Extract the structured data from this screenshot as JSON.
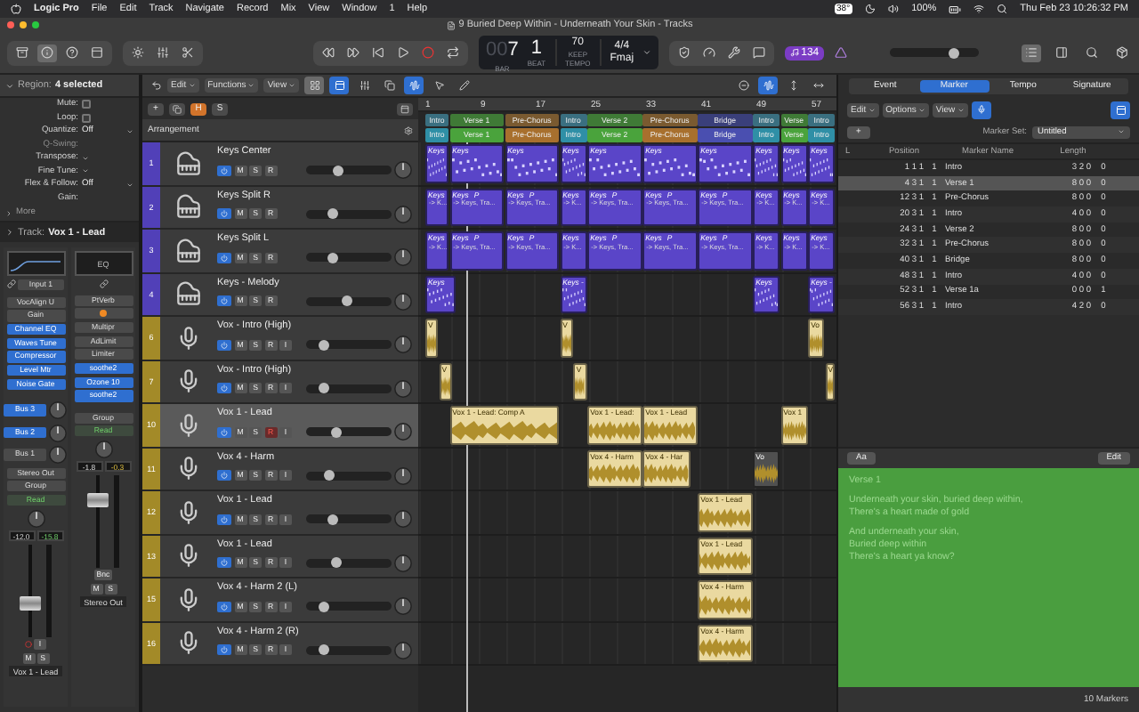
{
  "menu_bar": {
    "app": "Logic Pro",
    "items": [
      "File",
      "Edit",
      "Track",
      "Navigate",
      "Record",
      "Mix",
      "View",
      "Window",
      "1",
      "Help"
    ],
    "temperature": "38°",
    "battery": "100%",
    "clock": "Thu Feb 23  10:26:32 PM"
  },
  "window": {
    "title": "9 Buried Deep Within - Underneath Your Skin - Tracks"
  },
  "lcd": {
    "bar_prefix": "00",
    "bar": "7",
    "beat": "1",
    "bar_label": "BAR",
    "beat_label": "BEAT",
    "tempo": "70",
    "tempo_mode": "KEEP",
    "tempo_label": "TEMPO",
    "signature": "4/4",
    "key": "Fmaj"
  },
  "badge": "134",
  "master_volume": {
    "level": 0.72
  },
  "inspector": {
    "region_label": "Region:",
    "region_value": "4 selected",
    "params": [
      {
        "label": "Mute:",
        "kind": "checkbox",
        "checked": false,
        "disabled": false
      },
      {
        "label": "Loop:",
        "kind": "checkbox",
        "checked": false,
        "disabled": false
      },
      {
        "label": "Quantize:",
        "kind": "popup",
        "value": "Off",
        "disabled": false
      },
      {
        "label": "Q-Swing:",
        "kind": "label",
        "disabled": true
      },
      {
        "label": "Transpose:",
        "kind": "popup",
        "disabled": false
      },
      {
        "label": "Fine Tune:",
        "kind": "popup",
        "disabled": false
      },
      {
        "label": "Flex & Follow:",
        "kind": "popup",
        "value": "Off",
        "disabled": false
      },
      {
        "label": "Gain:",
        "kind": "label",
        "disabled": false
      }
    ],
    "more": "More",
    "track_label": "Track:",
    "track_value": "Vox 1 - Lead"
  },
  "strips": [
    {
      "eq": {
        "kind": "curve"
      },
      "input": "Input 1",
      "plugins": [
        {
          "name": "VocAlign U",
          "active": false,
          "warning": false
        },
        {
          "name": "Gain",
          "active": false,
          "warning": false
        },
        {
          "name": "Channel EQ",
          "active": true,
          "warning": false
        },
        {
          "name": "Waves Tune",
          "active": true,
          "warning": false
        },
        {
          "name": "Compressor",
          "active": true,
          "warning": false
        },
        {
          "name": "Level Mtr",
          "active": true,
          "warning": false
        },
        {
          "name": "Noise Gate",
          "active": true,
          "warning": false
        }
      ],
      "sends": [
        {
          "name": "Bus 3",
          "active": true
        },
        {
          "name": "Bus 2",
          "active": true
        },
        {
          "name": "Bus 1",
          "active": false
        }
      ],
      "output": "Stereo Out",
      "group": "Group",
      "automation": "Read",
      "volume": "-12.0",
      "peak": "-15.8",
      "level": 0.35,
      "input_button": "I",
      "mute": "M",
      "solo": "S",
      "name": "Vox 1 - Lead"
    },
    {
      "eq": {
        "kind": "label",
        "text": "EQ"
      },
      "plugins": [
        {
          "name": "PtVerb",
          "active": false,
          "warning": false
        },
        {
          "active": false,
          "warning": true
        },
        {
          "name": "Multipr",
          "active": false,
          "warning": false
        },
        {
          "name": "AdLimit",
          "active": false,
          "warning": false
        },
        {
          "name": "Limiter",
          "active": false,
          "warning": false
        },
        {
          "name": "soothe2",
          "active": true,
          "warning": false
        },
        {
          "name": "Ozone 10",
          "active": true,
          "warning": false
        },
        {
          "name": "soothe2",
          "active": true,
          "warning": false
        }
      ],
      "group": "Group",
      "automation": "Read",
      "volume": "-1.8",
      "peak": "-0.3",
      "level": 0.72,
      "bounce": "Bnc",
      "mute": "M",
      "solo": "S",
      "name": "Stereo Out"
    }
  ],
  "arrange_toolbar": {
    "menus": [
      "Edit",
      "Functions",
      "View"
    ]
  },
  "track_toolbar": {
    "add": "+",
    "h": "H",
    "s": "S",
    "arrangement": "Arrangement"
  },
  "ruler": [
    "1",
    "9",
    "17",
    "25",
    "33",
    "41",
    "49",
    "57"
  ],
  "arrangement_markers": [
    {
      "name": "Intro",
      "color": "#3a6f80"
    },
    {
      "name": "Verse 1",
      "color": "#3f7a36"
    },
    {
      "name": "Pre-Chorus",
      "color": "#7a5a30"
    },
    {
      "name": "Intro",
      "color": "#3a6f80"
    },
    {
      "name": "Verse 2",
      "color": "#3f7a36"
    },
    {
      "name": "Pre-Chorus",
      "color": "#7a5a30"
    },
    {
      "name": "Bridge",
      "color": "#3a3f7a"
    },
    {
      "name": "Intro",
      "color": "#3a6f80"
    },
    {
      "name": "Verse",
      "color": "#3f7a36"
    },
    {
      "name": "Intro",
      "color": "#3a6f80"
    }
  ],
  "markers": [
    {
      "name": "Intro",
      "color": "#2f8fa6"
    },
    {
      "name": "Verse 1",
      "color": "#4aa33c"
    },
    {
      "name": "Pre-Chorus",
      "color": "#a8702e"
    },
    {
      "name": "Intro",
      "color": "#2f8fa6"
    },
    {
      "name": "Verse 2",
      "color": "#4aa33c"
    },
    {
      "name": "Pre-Chorus",
      "color": "#a8702e"
    },
    {
      "name": "Bridge",
      "color": "#4a4fb0"
    },
    {
      "name": "Intro",
      "color": "#2f8fa6"
    },
    {
      "name": "Verse",
      "color": "#4aa33c"
    },
    {
      "name": "Intro",
      "color": "#2f8fa6"
    }
  ],
  "tracks": [
    {
      "number": "1",
      "name": "Keys Center",
      "kind": "keys",
      "buttons": [
        "M",
        "S",
        "R"
      ],
      "selected": false,
      "armed": false,
      "level": 0.38,
      "regions": [
        {
          "name": "Keys",
          "kind": "midi"
        },
        {
          "name": "Keys",
          "kind": "midi"
        },
        {
          "name": "Keys",
          "kind": "midi"
        },
        {
          "name": "Keys",
          "kind": "midi"
        },
        {
          "name": "Keys",
          "kind": "midi"
        },
        {
          "name": "Keys",
          "kind": "midi"
        },
        {
          "name": "Keys",
          "kind": "midi"
        },
        {
          "name": "Keys",
          "kind": "midi"
        },
        {
          "name": "Keys",
          "kind": "midi"
        },
        {
          "name": "Keys",
          "kind": "midi"
        }
      ]
    },
    {
      "number": "2",
      "name": "Keys Split R",
      "kind": "keys",
      "buttons": [
        "M",
        "S",
        "R"
      ],
      "selected": false,
      "armed": false,
      "level": 0.32,
      "regions": [
        {
          "name": "Keys",
          "sub": "-> K...",
          "kind": "midi"
        },
        {
          "name": "Keys",
          "tag": "P",
          "sub": "-> Keys, Tra...",
          "kind": "midi"
        },
        {
          "name": "Keys",
          "tag": "P",
          "sub": "-> Keys, Tra...",
          "kind": "midi"
        },
        {
          "name": "Keys",
          "sub": "-> K...",
          "kind": "midi"
        },
        {
          "name": "Keys",
          "tag": "P",
          "sub": "-> Keys, Tra...",
          "kind": "midi"
        },
        {
          "name": "Keys",
          "tag": "P",
          "sub": "-> Keys, Tra...",
          "kind": "midi"
        },
        {
          "name": "Keys",
          "tag": "P",
          "sub": "-> Keys, Tra...",
          "kind": "midi"
        },
        {
          "name": "Keys",
          "sub": "-> K...",
          "kind": "midi"
        },
        {
          "name": "Keys",
          "sub": "-> K...",
          "kind": "midi"
        },
        {
          "name": "Keys",
          "sub": "-> K...",
          "kind": "midi"
        }
      ]
    },
    {
      "number": "3",
      "name": "Keys Split L",
      "kind": "keys",
      "buttons": [
        "M",
        "S",
        "R"
      ],
      "selected": false,
      "armed": false,
      "level": 0.32,
      "regions": [
        {
          "name": "Keys",
          "sub": "-> K...",
          "kind": "midi"
        },
        {
          "name": "Keys",
          "tag": "P",
          "sub": "-> Keys, Tra...",
          "kind": "midi"
        },
        {
          "name": "Keys",
          "tag": "P",
          "sub": "-> Keys, Tra...",
          "kind": "midi"
        },
        {
          "name": "Keys",
          "sub": "-> K...",
          "kind": "midi"
        },
        {
          "name": "Keys",
          "tag": "P",
          "sub": "-> Keys, Tra...",
          "kind": "midi"
        },
        {
          "name": "Keys",
          "tag": "P",
          "sub": "-> Keys, Tra...",
          "kind": "midi"
        },
        {
          "name": "Keys",
          "tag": "P",
          "sub": "-> Keys, Tra...",
          "kind": "midi"
        },
        {
          "name": "Keys",
          "sub": "-> K...",
          "kind": "midi"
        },
        {
          "name": "Keys",
          "sub": "-> K...",
          "kind": "midi"
        },
        {
          "name": "Keys",
          "sub": "-> K...",
          "kind": "midi"
        }
      ]
    },
    {
      "number": "4",
      "name": "Keys - Melody",
      "kind": "keys",
      "buttons": [
        "M",
        "S",
        "R"
      ],
      "selected": false,
      "armed": false,
      "level": 0.48,
      "regions": [
        {
          "name": "Keys",
          "kind": "midi"
        },
        {
          "name": "Keys -",
          "kind": "midi"
        },
        {
          "name": "Keys",
          "kind": "midi"
        },
        {
          "name": "Keys -",
          "kind": "midi"
        }
      ]
    },
    {
      "number": "6",
      "name": "Vox - Intro (High)",
      "kind": "vox",
      "buttons": [
        "M",
        "S",
        "R",
        "I"
      ],
      "selected": false,
      "armed": false,
      "level": 0.22,
      "regions": [
        {
          "name": "V",
          "kind": "audio"
        },
        {
          "name": "V",
          "kind": "audio"
        },
        {
          "name": "Vo",
          "kind": "audio"
        }
      ]
    },
    {
      "number": "7",
      "name": "Vox - Intro (High)",
      "kind": "vox",
      "buttons": [
        "M",
        "S",
        "R",
        "I"
      ],
      "selected": false,
      "armed": false,
      "level": 0.22,
      "regions": [
        {
          "name": "V",
          "kind": "audio"
        },
        {
          "name": "V",
          "kind": "audio"
        },
        {
          "name": "V",
          "kind": "audio"
        }
      ]
    },
    {
      "number": "10",
      "name": "Vox 1 - Lead",
      "kind": "vox",
      "buttons": [
        "M",
        "S",
        "R",
        "I"
      ],
      "selected": true,
      "armed": true,
      "level": 0.37,
      "regions": [
        {
          "name": "Vox 1 - Lead: Comp A",
          "kind": "audio"
        },
        {
          "name": "Vox 1 - Lead:",
          "kind": "audio"
        },
        {
          "name": "Vox 1 - Lead",
          "kind": "audio"
        },
        {
          "name": "Vox 1",
          "kind": "audio"
        }
      ]
    },
    {
      "number": "11",
      "name": "Vox 4 - Harm",
      "kind": "vox",
      "buttons": [
        "M",
        "S",
        "R",
        "I"
      ],
      "selected": false,
      "armed": false,
      "level": 0.28,
      "regions": [
        {
          "name": "Vox 4 - Harm",
          "kind": "audio"
        },
        {
          "name": "Vox 4 - Har",
          "kind": "audio"
        },
        {
          "name": "Vo",
          "kind": "muted"
        }
      ]
    },
    {
      "number": "12",
      "name": "Vox 1 - Lead",
      "kind": "vox",
      "buttons": [
        "M",
        "S",
        "R",
        "I"
      ],
      "selected": false,
      "armed": false,
      "level": 0.32,
      "regions": [
        {
          "name": "Vox 1 - Lead",
          "kind": "audio"
        }
      ]
    },
    {
      "number": "13",
      "name": "Vox 1 - Lead",
      "kind": "vox",
      "buttons": [
        "M",
        "S",
        "R",
        "I"
      ],
      "selected": false,
      "armed": false,
      "level": 0.37,
      "regions": [
        {
          "name": "Vox 1 - Lead",
          "kind": "audio"
        }
      ]
    },
    {
      "number": "15",
      "name": "Vox 4 - Harm 2 (L)",
      "kind": "vox",
      "buttons": [
        "M",
        "S",
        "R",
        "I"
      ],
      "selected": false,
      "armed": false,
      "level": 0.22,
      "regions": [
        {
          "name": "Vox 4 - Harm",
          "kind": "audio"
        }
      ]
    },
    {
      "number": "16",
      "name": "Vox 4 - Harm 2 (R)",
      "kind": "vox",
      "buttons": [
        "M",
        "S",
        "R",
        "I"
      ],
      "selected": false,
      "armed": false,
      "level": 0.22,
      "regions": [
        {
          "name": "Vox 4 - Harm",
          "kind": "audio"
        }
      ]
    }
  ],
  "editor": {
    "tabs": [
      {
        "label": "Event",
        "selected": false
      },
      {
        "label": "Marker",
        "selected": true
      },
      {
        "label": "Tempo",
        "selected": false
      },
      {
        "label": "Signature",
        "selected": false
      }
    ],
    "menus": [
      "Edit",
      "Options",
      "View"
    ],
    "add": "+",
    "marker_set_label": "Marker Set:",
    "marker_set": "Untitled",
    "columns": [
      "L",
      "Position",
      "Marker Name",
      "Length"
    ],
    "rows": [
      {
        "position": "1 1 1",
        "tick": "1",
        "name": "Intro",
        "length": "3 2 0",
        "length_tick": "0",
        "selected": false
      },
      {
        "position": "4 3 1",
        "tick": "1",
        "name": "Verse 1",
        "length": "8 0 0",
        "length_tick": "0",
        "selected": true
      },
      {
        "position": "12 3 1",
        "tick": "1",
        "name": "Pre-Chorus",
        "length": "8 0 0",
        "length_tick": "0",
        "selected": false
      },
      {
        "position": "20 3 1",
        "tick": "1",
        "name": "Intro",
        "length": "4 0 0",
        "length_tick": "0",
        "selected": false
      },
      {
        "position": "24 3 1",
        "tick": "1",
        "name": "Verse 2",
        "length": "8 0 0",
        "length_tick": "0",
        "selected": false
      },
      {
        "position": "32 3 1",
        "tick": "1",
        "name": "Pre-Chorus",
        "length": "8 0 0",
        "length_tick": "0",
        "selected": false
      },
      {
        "position": "40 3 1",
        "tick": "1",
        "name": "Bridge",
        "length": "8 0 0",
        "length_tick": "0",
        "selected": false
      },
      {
        "position": "48 3 1",
        "tick": "1",
        "name": "Intro",
        "length": "4 0 0",
        "length_tick": "0",
        "selected": false
      },
      {
        "position": "52 3 1",
        "tick": "1",
        "name": "Verse 1a",
        "length": "0 0 0",
        "length_tick": "1",
        "selected": false
      },
      {
        "position": "56 3 1",
        "tick": "1",
        "name": "Intro",
        "length": "4 2 0",
        "length_tick": "0",
        "selected": false
      }
    ],
    "text_button": "Aa",
    "edit_button": "Edit",
    "lyrics": [
      [
        "Verse 1"
      ],
      [
        "Underneath your skin, buried deep within,",
        "There's a heart made of gold"
      ],
      [
        "And underneath your skin,",
        "Buried deep within",
        "There's a heart ya know?"
      ]
    ],
    "footer": "10 Markers"
  }
}
